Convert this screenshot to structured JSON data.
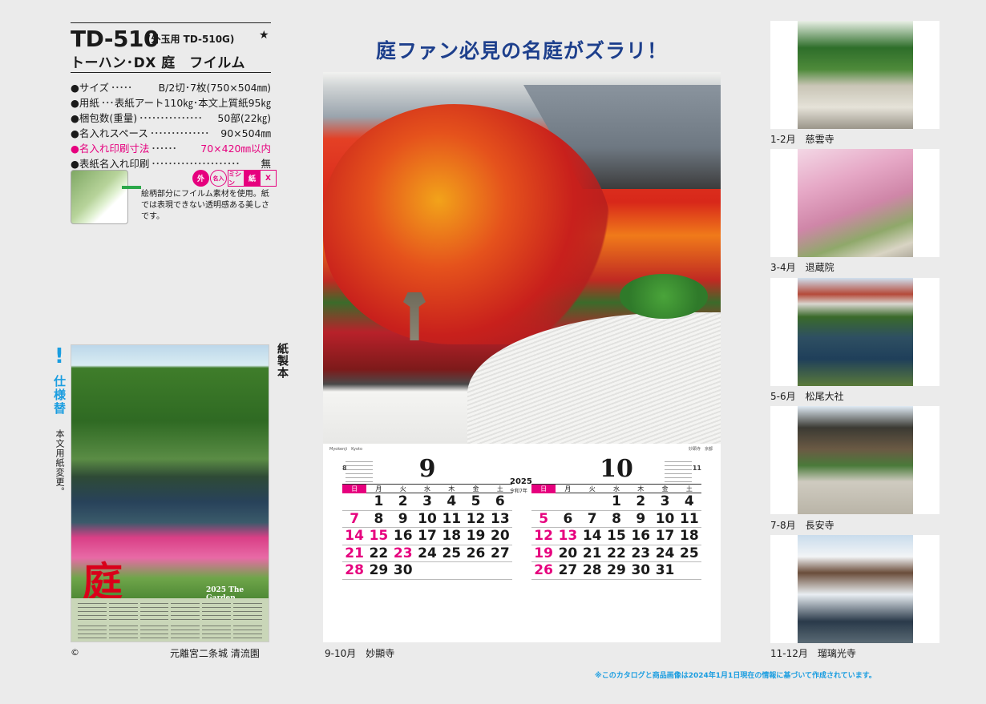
{
  "product": {
    "code": "TD-510",
    "sub": "(外玉用 TD-510G)",
    "star": "★",
    "title": "トーハン･DX 庭　フイルム"
  },
  "specs": [
    {
      "label": "●サイズ",
      "dots": "･････",
      "value": "B/2切･7枚(750×504㎜)"
    },
    {
      "label": "●用紙",
      "dots": "･･･",
      "value": "表紙アート110㎏･本文上質紙95㎏"
    },
    {
      "label": "●梱包数(重量)",
      "dots": "･･･････････････",
      "value": "50部(22㎏)"
    },
    {
      "label": "●名入れスペース",
      "dots": "･･････････････",
      "value": "90×504㎜"
    },
    {
      "label": "●名入れ印刷寸法",
      "dots": "･･････",
      "value": "70×420㎜以内",
      "highlight": true
    },
    {
      "label": "●表紙名入れ印刷",
      "dots": "･････････････････････",
      "value": "無"
    }
  ],
  "badges": {
    "soto": "外",
    "meiire": "名入",
    "mishin": "ミシン",
    "kami": "紙",
    "x": "X"
  },
  "film_note": "絵柄部分にフイルム素材を使用。紙では表現できない透明感ある美しさです。",
  "spec_change": {
    "mark": "!",
    "title": "仕様替",
    "note": "本文用紙変更。"
  },
  "paper_bound": "紙製本",
  "cover": {
    "kanji": "庭",
    "label": "2025 The Garden",
    "caption": "元離宮二条城 清流園",
    "copyright": "©"
  },
  "headline": "庭ファン必見の名庭がズラリ！",
  "main_calendar": {
    "year": "2025",
    "era": "令和7年",
    "photo_left": "Myokenji　Kyoto",
    "photo_right": "妙顕寺　京都",
    "weekdays": [
      "日",
      "月",
      "火",
      "水",
      "木",
      "金",
      "土"
    ],
    "months": [
      {
        "num": "9",
        "prev": "8",
        "next": "",
        "days": [
          "",
          "1",
          "2",
          "3",
          "4",
          "5",
          "6",
          "7",
          "8",
          "9",
          "10",
          "11",
          "12",
          "13",
          "14",
          "15",
          "16",
          "17",
          "18",
          "19",
          "20",
          "21",
          "22",
          "23",
          "24",
          "25",
          "26",
          "27",
          "28",
          "29",
          "30",
          "",
          "",
          "",
          ""
        ],
        "holidays": [
          "15",
          "23"
        ]
      },
      {
        "num": "10",
        "prev": "",
        "next": "11",
        "days": [
          "",
          "",
          "",
          "1",
          "2",
          "3",
          "4",
          "5",
          "6",
          "7",
          "8",
          "9",
          "10",
          "11",
          "12",
          "13",
          "14",
          "15",
          "16",
          "17",
          "18",
          "19",
          "20",
          "21",
          "22",
          "23",
          "24",
          "25",
          "26",
          "27",
          "28",
          "29",
          "30",
          "31",
          ""
        ],
        "holidays": [
          "13"
        ]
      }
    ],
    "caption": "9-10月　妙顯寺"
  },
  "thumbnails": [
    {
      "caption": "1-2月　慈雲寺"
    },
    {
      "caption": "3-4月　退蔵院"
    },
    {
      "caption": "5-6月　松尾大社"
    },
    {
      "caption": "7-8月　長安寺"
    },
    {
      "caption": "11-12月　瑠璃光寺"
    }
  ],
  "footer_note": "※このカタログと商品画像は2024年1月1日現在の情報に基づいて作成されています。",
  "colors": {
    "accent_pink": "#e6007e",
    "headline_blue": "#1d3f8c",
    "note_blue": "#1a9de0"
  }
}
